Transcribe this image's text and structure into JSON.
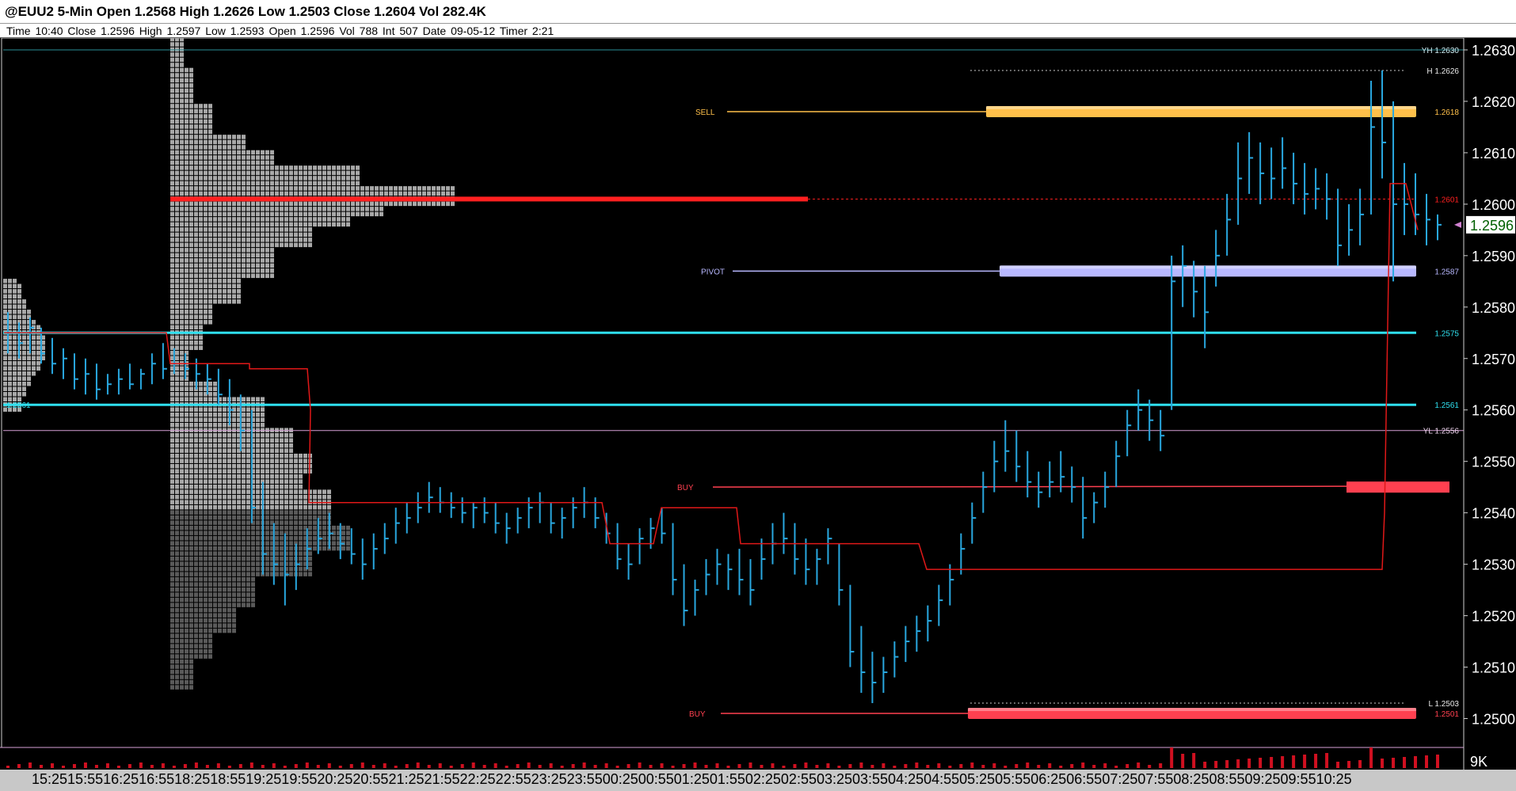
{
  "header": {
    "title": "@EUU2 5-Min Open 1.2568 High 1.2626 Low 1.2503 Close 1.2604 Vol 282.4K",
    "info": "Time 10:40   Close 1.2596   High 1.2597   Low 1.2593   Open 1.2596   Vol 788   Int 507   Date 09-05-12   Timer 2:21"
  },
  "colors": {
    "background": "#000000",
    "price_bars": "#29a8e0",
    "level_cyan": "#2fe0ef",
    "sell_zone": "#ffc04a",
    "pivot_zone": "#b8b8ff",
    "buy_zone": "#ff4050",
    "profile_light": "#a8a8a8",
    "profile_dark": "#5a5a5a",
    "poc": "#ff2020",
    "vwap_line": "#e01818",
    "current_price_bg": "#ffffff",
    "current_price_fg": "#006000"
  },
  "chart_data": {
    "type": "candlestick-bar",
    "symbol": "@EUU2",
    "interval": "5-Min",
    "ylim": [
      1.2495,
      1.2632
    ],
    "yticks": [
      "1.2630",
      "1.2620",
      "1.2610",
      "1.2600",
      "1.2590",
      "1.2580",
      "1.2570",
      "1.2560",
      "1.2550",
      "1.2540",
      "1.2530",
      "1.2520",
      "1.2510",
      "1.2500"
    ],
    "current_price": "1.2596",
    "volume_label": "9K",
    "time_axis": "15:2515:5516:2516:5518:2518:5519:2519:5520:2520:5521:2521:5522:2522:5523:2523:5500:2500:5501:2501:5502:2502:5503:2503:5504:2504:5505:2505:5506:2506:5507:2507:5508:2508:5509:2509:5510:25",
    "levels": [
      {
        "label": "YH 1.2630",
        "price": 1.263,
        "style": "thin-cyan"
      },
      {
        "label": "H 1.2626",
        "price": 1.2626,
        "style": "dotted"
      },
      {
        "label": "1.2618",
        "price": 1.2618,
        "style": "zone-sell",
        "tag": "SELL"
      },
      {
        "label": "1.2601",
        "price": 1.2601,
        "style": "poc"
      },
      {
        "label": "1.2587",
        "price": 1.2587,
        "style": "zone-pivot",
        "tag": "PIVOT"
      },
      {
        "label": "1.2575",
        "price": 1.2575,
        "style": "cyan"
      },
      {
        "label": "1.2561",
        "price": 1.2561,
        "style": "cyan"
      },
      {
        "label": "YL 1.2556",
        "price": 1.2556,
        "style": "thin-pink"
      },
      {
        "label": "1.2545",
        "price": 1.2545,
        "style": "buy-line",
        "tag": "BUY"
      },
      {
        "label": "L 1.2503",
        "price": 1.2503,
        "style": "dotted"
      },
      {
        "label": "1.2501",
        "price": 1.2501,
        "style": "zone-buy",
        "tag": "BUY"
      }
    ],
    "left_cyan_label": "1.2561",
    "bars": [
      [
        1.2579,
        1.2571,
        1.2575
      ],
      [
        1.2577,
        1.257,
        1.2573
      ],
      [
        1.2578,
        1.2571,
        1.2576
      ],
      [
        1.2576,
        1.2569,
        1.2571
      ],
      [
        1.2574,
        1.2567,
        1.2569
      ],
      [
        1.2572,
        1.2566,
        1.257
      ],
      [
        1.2571,
        1.2564,
        1.2566
      ],
      [
        1.257,
        1.2563,
        1.2567
      ],
      [
        1.2569,
        1.2562,
        1.2564
      ],
      [
        1.2567,
        1.2563,
        1.2565
      ],
      [
        1.2568,
        1.2563,
        1.2566
      ],
      [
        1.2569,
        1.2564,
        1.2565
      ],
      [
        1.2568,
        1.2564,
        1.2567
      ],
      [
        1.2571,
        1.2565,
        1.2569
      ],
      [
        1.2573,
        1.2566,
        1.2568
      ],
      [
        1.2572,
        1.2567,
        1.2569
      ],
      [
        1.2571,
        1.2566,
        1.2568
      ],
      [
        1.257,
        1.2564,
        1.2567
      ],
      [
        1.2569,
        1.2563,
        1.2566
      ],
      [
        1.2568,
        1.2561,
        1.2563
      ],
      [
        1.2566,
        1.2557,
        1.256
      ],
      [
        1.2563,
        1.2552,
        1.2556
      ],
      [
        1.256,
        1.2538,
        1.2541
      ],
      [
        1.2546,
        1.2528,
        1.2532
      ],
      [
        1.2538,
        1.2526,
        1.253
      ],
      [
        1.2536,
        1.2522,
        1.2528
      ],
      [
        1.2534,
        1.2525,
        1.253
      ],
      [
        1.2537,
        1.2529,
        1.2533
      ],
      [
        1.2539,
        1.2532,
        1.2535
      ],
      [
        1.254,
        1.2533,
        1.2536
      ],
      [
        1.2538,
        1.2531,
        1.2534
      ],
      [
        1.2537,
        1.253,
        1.2532
      ],
      [
        1.2535,
        1.2527,
        1.253
      ],
      [
        1.2536,
        1.2529,
        1.2533
      ],
      [
        1.2538,
        1.2532,
        1.2535
      ],
      [
        1.2541,
        1.2534,
        1.2538
      ],
      [
        1.2542,
        1.2536,
        1.2539
      ],
      [
        1.2544,
        1.2538,
        1.2541
      ],
      [
        1.2546,
        1.254,
        1.2543
      ],
      [
        1.2545,
        1.254,
        1.2542
      ],
      [
        1.2544,
        1.2539,
        1.2541
      ],
      [
        1.2543,
        1.2538,
        1.254
      ],
      [
        1.2542,
        1.2537,
        1.2541
      ],
      [
        1.2543,
        1.2538,
        1.254
      ],
      [
        1.2542,
        1.2536,
        1.2538
      ],
      [
        1.254,
        1.2534,
        1.2537
      ],
      [
        1.2541,
        1.2536,
        1.2539
      ],
      [
        1.2543,
        1.2537,
        1.2541
      ],
      [
        1.2544,
        1.2538,
        1.2542
      ],
      [
        1.2542,
        1.2536,
        1.2538
      ],
      [
        1.2541,
        1.2535,
        1.2539
      ],
      [
        1.2543,
        1.2537,
        1.2541
      ],
      [
        1.2545,
        1.2539,
        1.2542
      ],
      [
        1.2543,
        1.2537,
        1.2539
      ],
      [
        1.254,
        1.2534,
        1.2536
      ],
      [
        1.2538,
        1.2529,
        1.2531
      ],
      [
        1.2534,
        1.2527,
        1.253
      ],
      [
        1.2537,
        1.253,
        1.2535
      ],
      [
        1.2539,
        1.2533,
        1.2537
      ],
      [
        1.2541,
        1.2534,
        1.2536
      ],
      [
        1.2538,
        1.2524,
        1.2527
      ],
      [
        1.253,
        1.2518,
        1.2521
      ],
      [
        1.2527,
        1.252,
        1.2525
      ],
      [
        1.2531,
        1.2524,
        1.2528
      ],
      [
        1.2533,
        1.2526,
        1.253
      ],
      [
        1.2532,
        1.2525,
        1.2529
      ],
      [
        1.2533,
        1.2524,
        1.2527
      ],
      [
        1.2531,
        1.2522,
        1.2525
      ],
      [
        1.2535,
        1.2527,
        1.2531
      ],
      [
        1.2538,
        1.253,
        1.2534
      ],
      [
        1.254,
        1.2532,
        1.2535
      ],
      [
        1.2538,
        1.2528,
        1.2531
      ],
      [
        1.2535,
        1.2526,
        1.2529
      ],
      [
        1.2533,
        1.2526,
        1.2531
      ],
      [
        1.2537,
        1.253,
        1.2535
      ],
      [
        1.2534,
        1.2522,
        1.2525
      ],
      [
        1.2526,
        1.251,
        1.2513
      ],
      [
        1.2518,
        1.2505,
        1.2509
      ],
      [
        1.2513,
        1.2503,
        1.2507
      ],
      [
        1.2512,
        1.2505,
        1.2509
      ],
      [
        1.2515,
        1.2508,
        1.2512
      ],
      [
        1.2518,
        1.2511,
        1.2515
      ],
      [
        1.252,
        1.2513,
        1.2517
      ],
      [
        1.2522,
        1.2515,
        1.2519
      ],
      [
        1.2526,
        1.2518,
        1.2523
      ],
      [
        1.253,
        1.2522,
        1.2527
      ],
      [
        1.2536,
        1.2528,
        1.2533
      ],
      [
        1.2542,
        1.2534,
        1.2539
      ],
      [
        1.2548,
        1.254,
        1.2545
      ],
      [
        1.2554,
        1.2544,
        1.255
      ],
      [
        1.2558,
        1.2548,
        1.2552
      ],
      [
        1.2556,
        1.2546,
        1.2549
      ],
      [
        1.2552,
        1.2543,
        1.2546
      ],
      [
        1.2548,
        1.2541,
        1.2544
      ],
      [
        1.255,
        1.2543,
        1.2546
      ],
      [
        1.2552,
        1.2544,
        1.2547
      ],
      [
        1.2549,
        1.2542,
        1.2545
      ],
      [
        1.2547,
        1.2535,
        1.2539
      ],
      [
        1.2544,
        1.2538,
        1.2542
      ],
      [
        1.2548,
        1.2541,
        1.2545
      ],
      [
        1.2554,
        1.2545,
        1.2551
      ],
      [
        1.256,
        1.2551,
        1.2557
      ],
      [
        1.2564,
        1.2556,
        1.256
      ],
      [
        1.2562,
        1.2554,
        1.2558
      ],
      [
        1.256,
        1.2552,
        1.2555
      ],
      [
        1.259,
        1.256,
        1.2585
      ],
      [
        1.2592,
        1.258,
        1.2588
      ],
      [
        1.2589,
        1.2578,
        1.2583
      ],
      [
        1.2588,
        1.2572,
        1.2579
      ],
      [
        1.2595,
        1.2584,
        1.259
      ],
      [
        1.2602,
        1.259,
        1.2597
      ],
      [
        1.2612,
        1.2596,
        1.2605
      ],
      [
        1.2614,
        1.2602,
        1.2609
      ],
      [
        1.2612,
        1.26,
        1.2606
      ],
      [
        1.2611,
        1.2601,
        1.2605
      ],
      [
        1.2613,
        1.2603,
        1.2607
      ],
      [
        1.261,
        1.26,
        1.2604
      ],
      [
        1.2608,
        1.2598,
        1.2602
      ],
      [
        1.2607,
        1.2599,
        1.2603
      ],
      [
        1.2606,
        1.2597,
        1.2601
      ],
      [
        1.2603,
        1.2588,
        1.2592
      ],
      [
        1.26,
        1.259,
        1.2595
      ],
      [
        1.2603,
        1.2592,
        1.2598
      ],
      [
        1.2624,
        1.2598,
        1.2615
      ],
      [
        1.2626,
        1.2605,
        1.2612
      ],
      [
        1.262,
        1.2585,
        1.26
      ],
      [
        1.2608,
        1.2594,
        1.26
      ],
      [
        1.2606,
        1.2594,
        1.2598
      ],
      [
        1.2602,
        1.2592,
        1.2597
      ],
      [
        1.2598,
        1.2593,
        1.2596
      ]
    ],
    "volume_spikes": [
      0,
      0,
      0,
      0,
      0,
      0,
      0,
      0,
      0,
      0,
      0,
      0,
      0,
      0,
      0,
      0,
      0,
      0,
      0,
      0,
      0,
      0,
      0,
      0,
      0,
      0,
      0,
      0,
      0,
      0,
      0,
      0,
      0,
      0,
      0,
      0,
      0,
      0,
      0,
      0,
      0,
      0,
      0,
      0,
      0,
      0,
      0,
      0,
      0,
      0,
      0,
      0,
      0,
      0,
      0,
      0,
      0,
      0,
      0,
      0,
      0,
      0,
      0,
      0,
      0,
      0,
      0,
      0,
      0,
      0,
      0,
      0,
      0,
      0,
      0,
      0,
      0,
      0,
      0,
      0,
      0,
      0,
      0,
      0,
      0,
      0,
      0,
      0,
      0,
      0,
      0,
      0,
      0,
      0,
      0,
      0,
      0,
      0,
      0,
      0,
      0,
      0,
      0,
      0,
      0,
      0,
      0,
      0,
      0,
      0,
      0,
      0,
      0,
      0,
      0,
      0,
      0,
      0,
      0,
      0,
      0,
      0,
      0,
      0,
      0,
      0,
      0,
      0,
      0,
      0
    ],
    "volume_profile": {
      "price_step": 0.0001,
      "poc": 1.2601,
      "light_rows": [
        [
          1.2627,
          1.2632,
          3
        ],
        [
          1.262,
          1.2626,
          5
        ],
        [
          1.2614,
          1.2619,
          9
        ],
        [
          1.2611,
          1.2613,
          16
        ],
        [
          1.2608,
          1.261,
          22
        ],
        [
          1.2604,
          1.2607,
          40
        ],
        [
          1.26,
          1.2603,
          60
        ],
        [
          1.2598,
          1.2599,
          45
        ],
        [
          1.2596,
          1.2597,
          38
        ],
        [
          1.2592,
          1.2595,
          30
        ],
        [
          1.2586,
          1.2591,
          22
        ],
        [
          1.2581,
          1.2585,
          15
        ],
        [
          1.2577,
          1.258,
          9
        ],
        [
          1.2572,
          1.2576,
          7
        ],
        [
          1.2566,
          1.2571,
          4
        ],
        [
          1.2563,
          1.2565,
          10
        ],
        [
          1.2557,
          1.2562,
          20
        ],
        [
          1.2552,
          1.2556,
          26
        ],
        [
          1.2548,
          1.2551,
          30
        ],
        [
          1.2545,
          1.2547,
          28
        ],
        [
          1.2541,
          1.2544,
          34
        ]
      ],
      "dark_rows": [
        [
          1.2538,
          1.254,
          34
        ],
        [
          1.2533,
          1.2537,
          38
        ],
        [
          1.2528,
          1.2532,
          30
        ],
        [
          1.2522,
          1.2527,
          18
        ],
        [
          1.2517,
          1.2521,
          14
        ],
        [
          1.2512,
          1.2516,
          9
        ],
        [
          1.2506,
          1.2511,
          5
        ]
      ]
    }
  }
}
